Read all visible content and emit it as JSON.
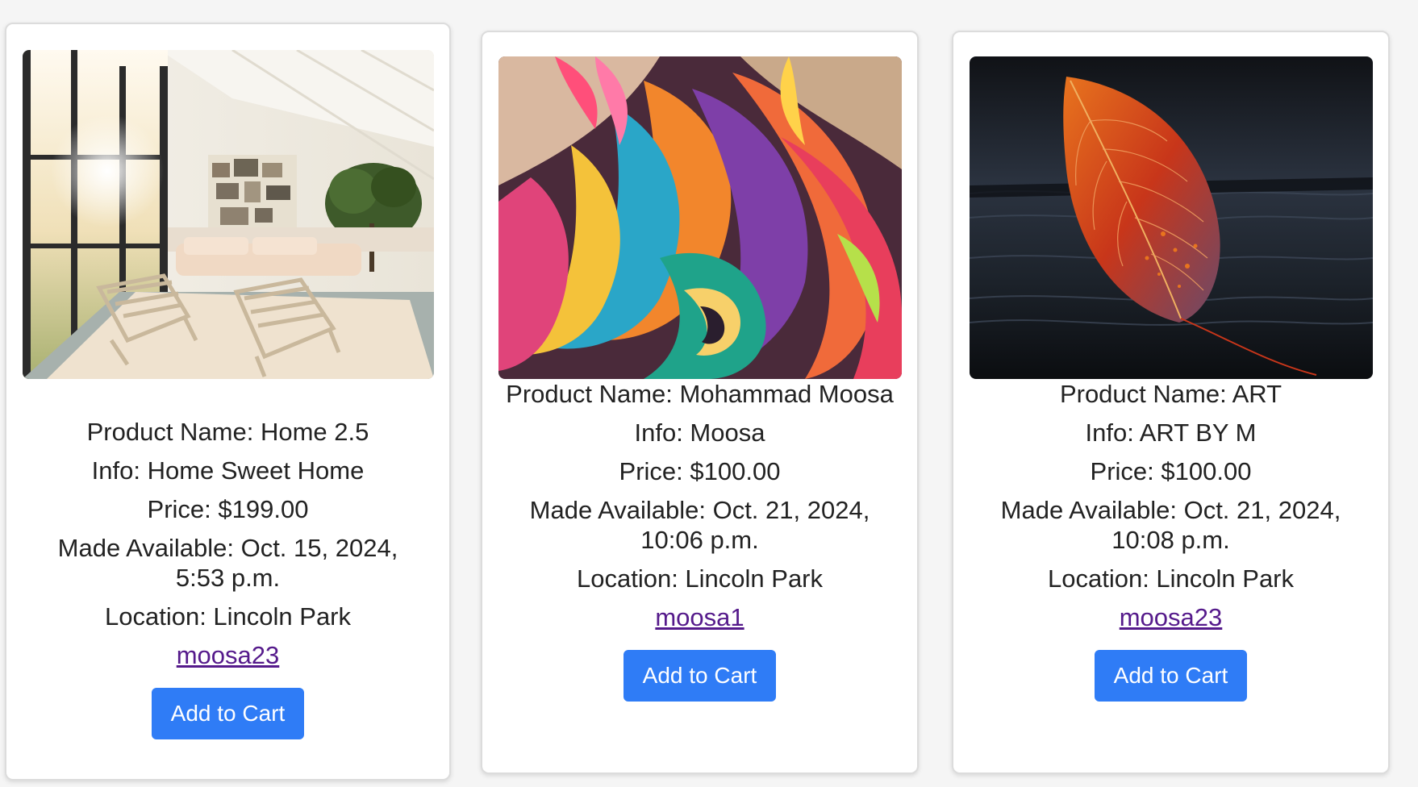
{
  "products": [
    {
      "name_line": "Product Name: Home 2.5",
      "info_line": "Info: Home Sweet Home",
      "price_line": "Price: $199.00",
      "available_line_1": "Made Available: Oct. 15, 2024,",
      "available_line_2": "5:53 p.m.",
      "location_line": "Location: Lincoln Park",
      "seller": "moosa23",
      "button_label": "Add to Cart",
      "image": "living-room-photo"
    },
    {
      "name_line": "Product Name: Mohammad Moosa",
      "info_line": "Info: Moosa",
      "price_line": "Price: $100.00",
      "available_line_1": "Made Available: Oct. 21, 2024,",
      "available_line_2": "10:06 p.m.",
      "location_line": "Location: Lincoln Park",
      "seller": "moosa1",
      "button_label": "Add to Cart",
      "image": "abstract-swirl-art"
    },
    {
      "name_line": "Product Name: ART",
      "info_line": "Info: ART BY M",
      "price_line": "Price: $100.00",
      "available_line_1": "Made Available: Oct. 21, 2024,",
      "available_line_2": "10:08 p.m.",
      "location_line": "Location: Lincoln Park",
      "seller": "moosa23",
      "button_label": "Add to Cart",
      "image": "autumn-leaf-photo"
    }
  ],
  "colors": {
    "button": "#2f7cf6",
    "link_visited": "#551a8b",
    "text": "#222222"
  }
}
